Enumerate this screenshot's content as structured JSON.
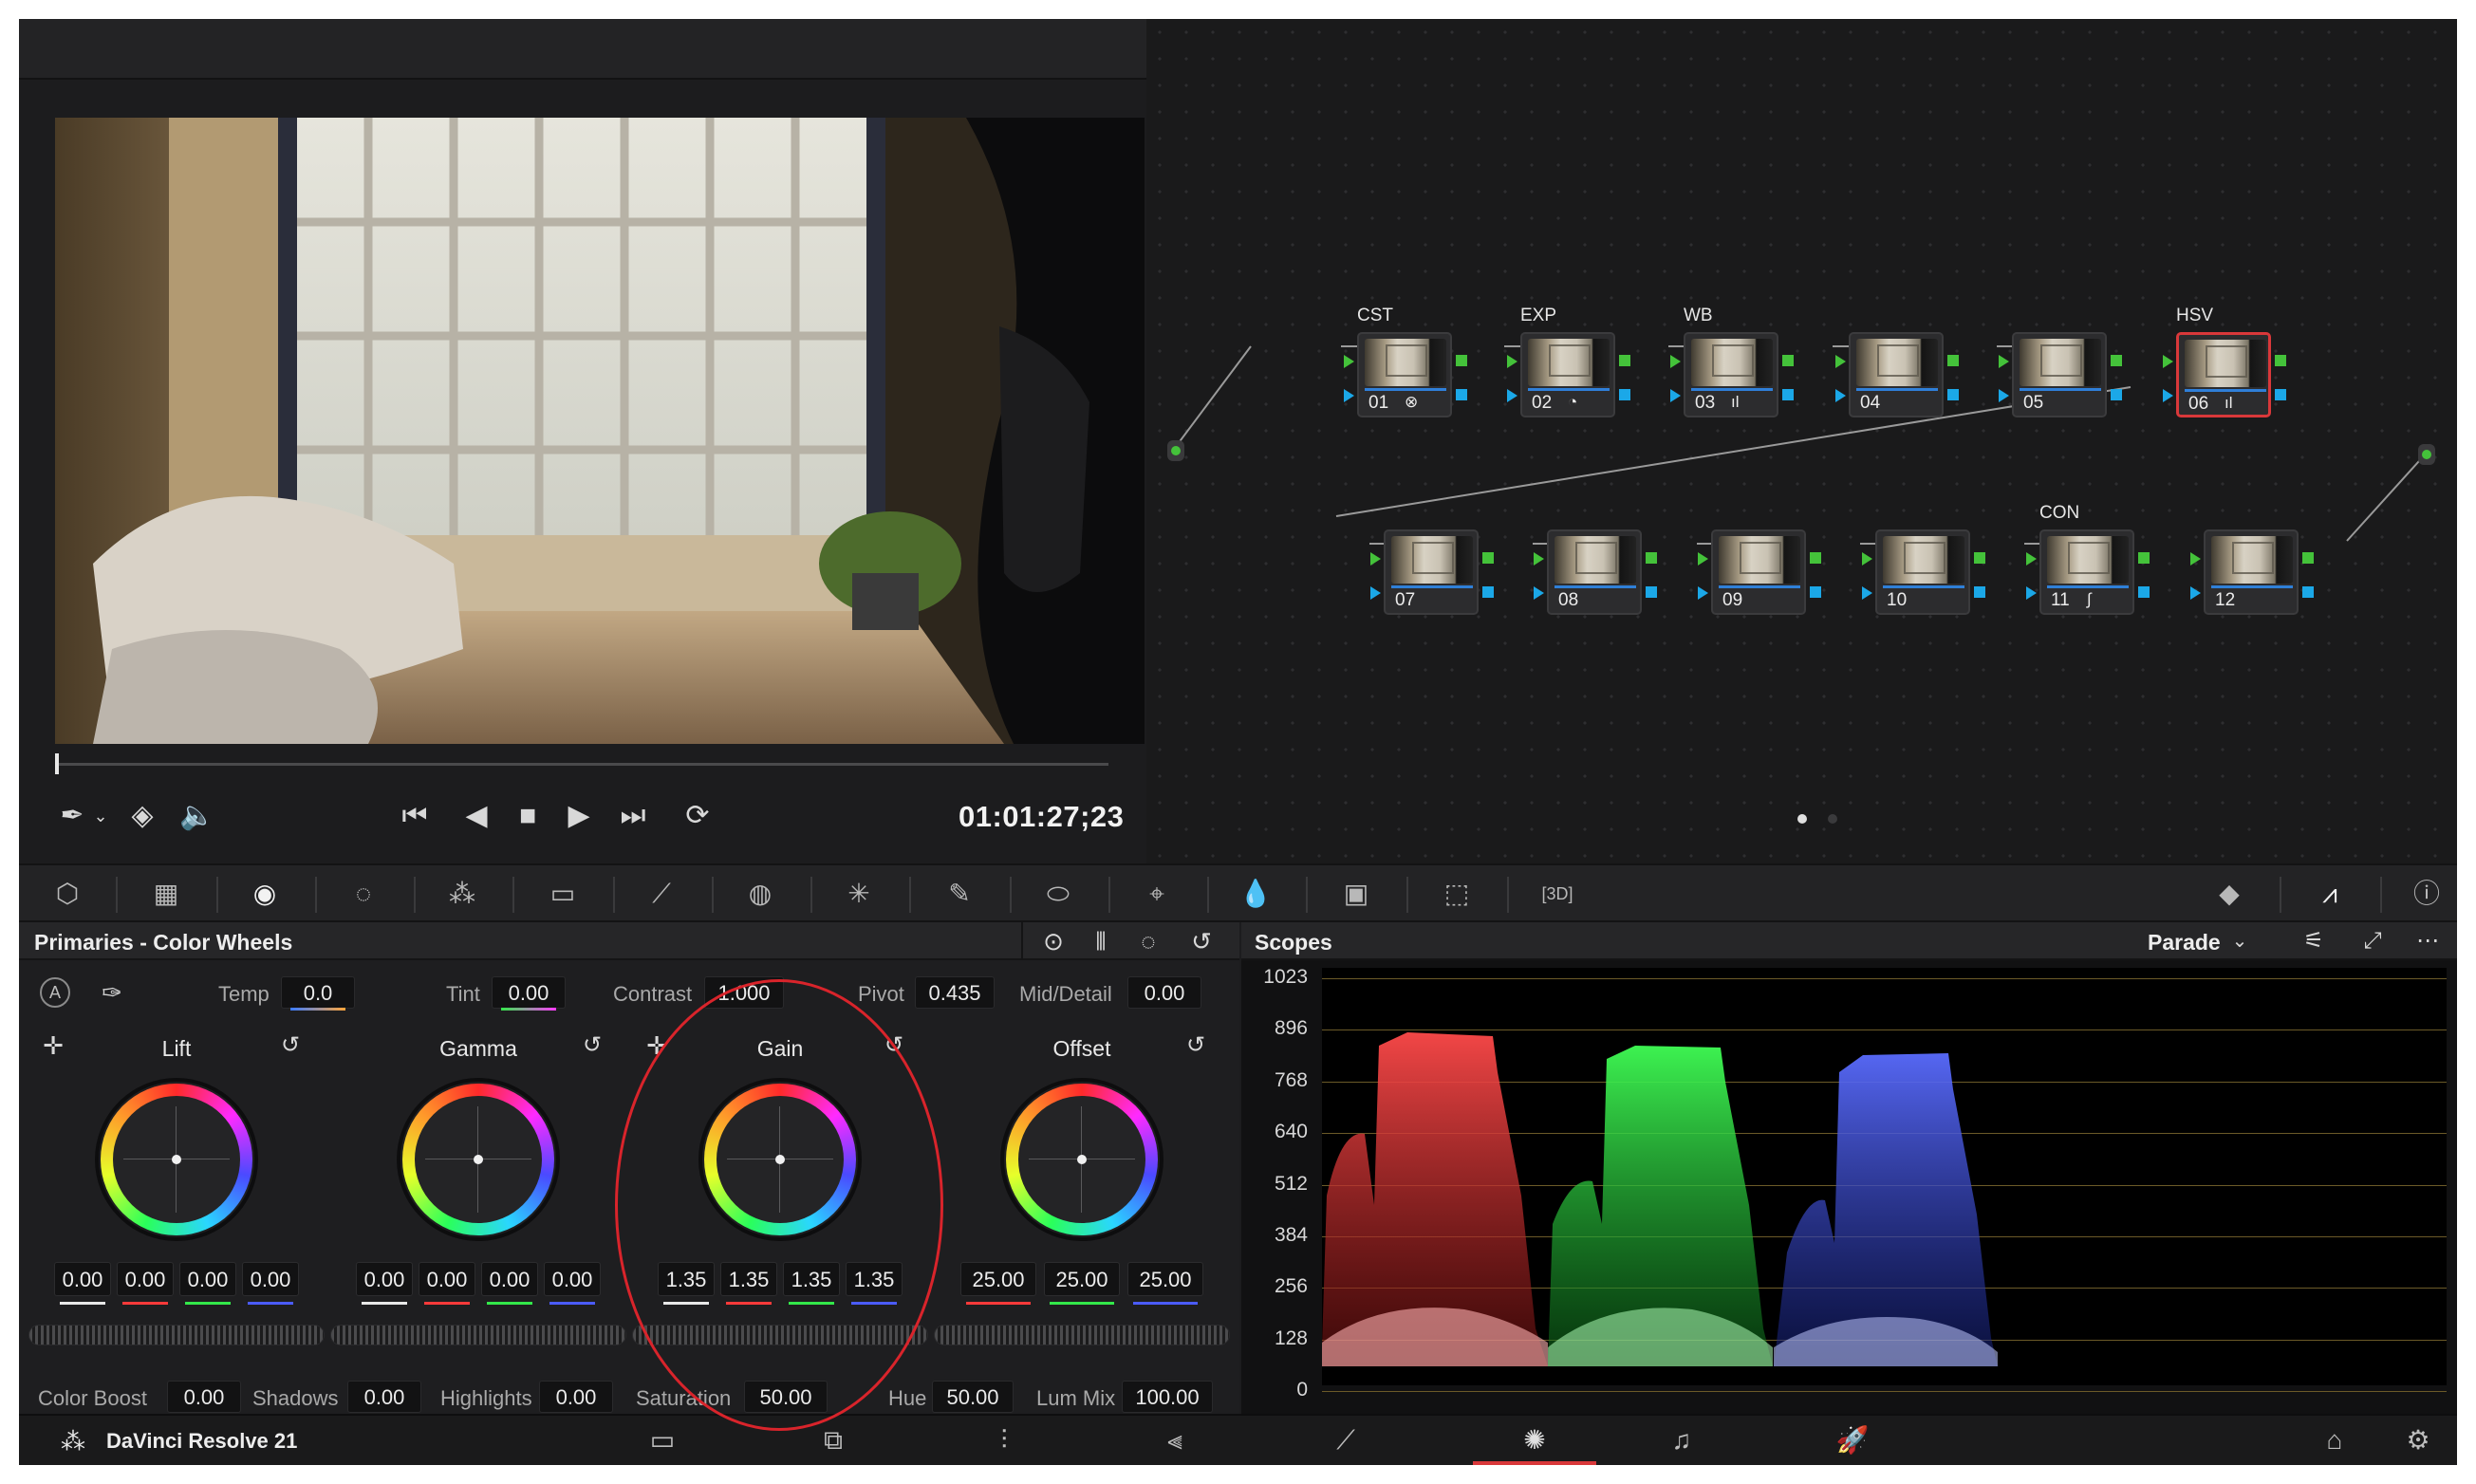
{
  "viewer": {
    "timecode": "01:01:27;23"
  },
  "nodes": {
    "row1": [
      {
        "label": "CST",
        "num": "01",
        "icon": "⊗"
      },
      {
        "label": "EXP",
        "num": "02",
        "icon": "◔"
      },
      {
        "label": "WB",
        "num": "03",
        "icon": "ıl"
      },
      {
        "label": "",
        "num": "04",
        "icon": ""
      },
      {
        "label": "",
        "num": "05",
        "icon": ""
      },
      {
        "label": "HSV",
        "num": "06",
        "icon": "ıl"
      }
    ],
    "row2": [
      {
        "label": "",
        "num": "07",
        "icon": ""
      },
      {
        "label": "",
        "num": "08",
        "icon": ""
      },
      {
        "label": "",
        "num": "09",
        "icon": ""
      },
      {
        "label": "",
        "num": "10",
        "icon": ""
      },
      {
        "label": "CON",
        "num": "11",
        "icon": "∫"
      },
      {
        "label": "",
        "num": "12",
        "icon": ""
      }
    ]
  },
  "primaries": {
    "title": "Primaries - Color Wheels",
    "auto_label": "A",
    "temp_label": "Temp",
    "temp": "0.0",
    "tint_label": "Tint",
    "tint": "0.00",
    "contrast_label": "Contrast",
    "contrast": "1.000",
    "pivot_label": "Pivot",
    "pivot": "0.435",
    "middetail_label": "Mid/Detail",
    "middetail": "0.00",
    "wheels": [
      {
        "name": "Lift",
        "values": [
          "0.00",
          "0.00",
          "0.00",
          "0.00"
        ]
      },
      {
        "name": "Gamma",
        "values": [
          "0.00",
          "0.00",
          "0.00",
          "0.00"
        ]
      },
      {
        "name": "Gain",
        "values": [
          "1.35",
          "1.35",
          "1.35",
          "1.35"
        ]
      },
      {
        "name": "Offset",
        "values": [
          "25.00",
          "25.00",
          "25.00"
        ]
      }
    ],
    "colorboost_label": "Color Boost",
    "colorboost": "0.00",
    "shadows_label": "Shadows",
    "shadows": "0.00",
    "highlights_label": "Highlights",
    "highlights": "0.00",
    "saturation_label": "Saturation",
    "saturation": "50.00",
    "hue_label": "Hue",
    "hue": "50.00",
    "lummix_label": "Lum Mix",
    "lummix": "100.00"
  },
  "scopes": {
    "title": "Scopes",
    "mode": "Parade",
    "ticks": [
      "1023",
      "896",
      "768",
      "640",
      "512",
      "384",
      "256",
      "128",
      "0"
    ]
  },
  "app": {
    "name": "DaVinci Resolve 21"
  },
  "colors": {
    "red": "#ff3a3a",
    "green": "#33e84a",
    "blue": "#4b5cff",
    "selection": "#d9383a"
  }
}
